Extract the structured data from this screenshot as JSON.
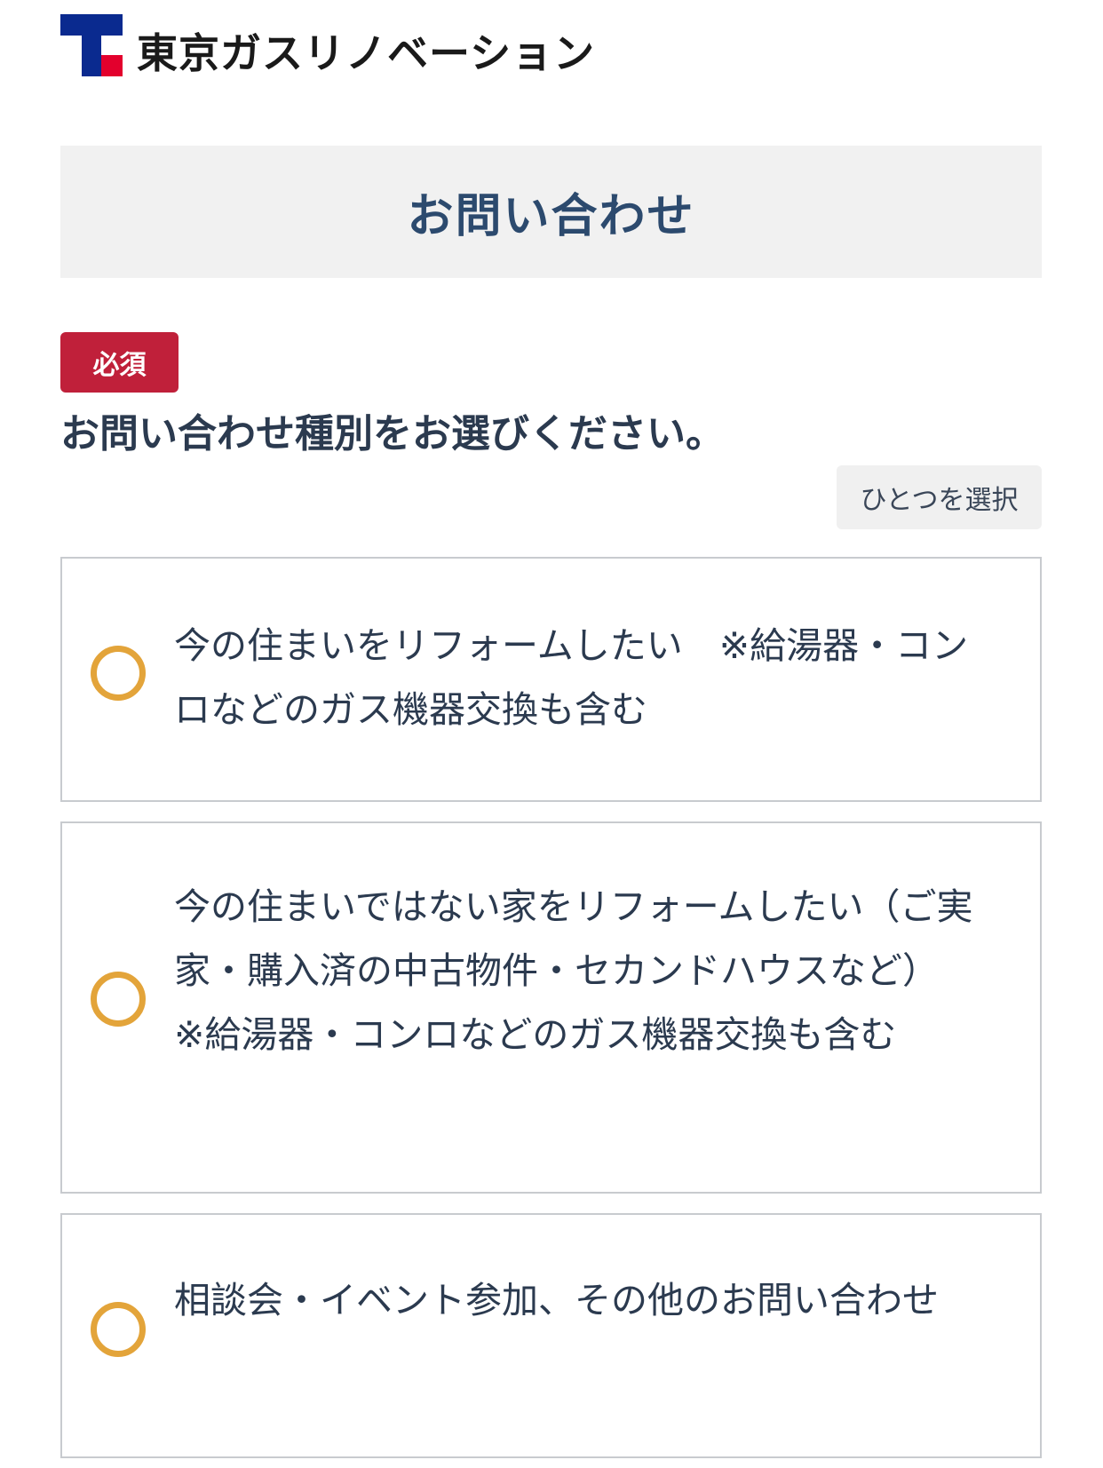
{
  "header": {
    "brand_name": "東京ガスリノベーション"
  },
  "page": {
    "title": "お問い合わせ"
  },
  "form": {
    "required_badge": "必須",
    "question": "お問い合わせ種別をお選びください。",
    "select_hint": "ひとつを選択",
    "options": [
      {
        "label": "今の住まいをリフォームしたい　※給湯器・コンロなどのガス機器交換も含む"
      },
      {
        "label": "今の住まいではない家をリフォームしたい（ご実家・購入済の中古物件・セカンドハウスなど）　※給湯器・コンロなどのガス機器交換も含む"
      },
      {
        "label": "相談会・イベント参加、その他のお問い合わせ"
      }
    ]
  },
  "colors": {
    "brand_blue": "#0a2a8f",
    "brand_red": "#e3002d",
    "title_text": "#2c4a6e",
    "required_badge_bg": "#c0203a",
    "radio_ring": "#e3a43a",
    "option_border": "#c8cbcf",
    "banner_bg": "#f1f1f1"
  },
  "icons": {
    "logo": "tokyo-gas-logo-mark",
    "radio": "radio-unselected-icon"
  }
}
